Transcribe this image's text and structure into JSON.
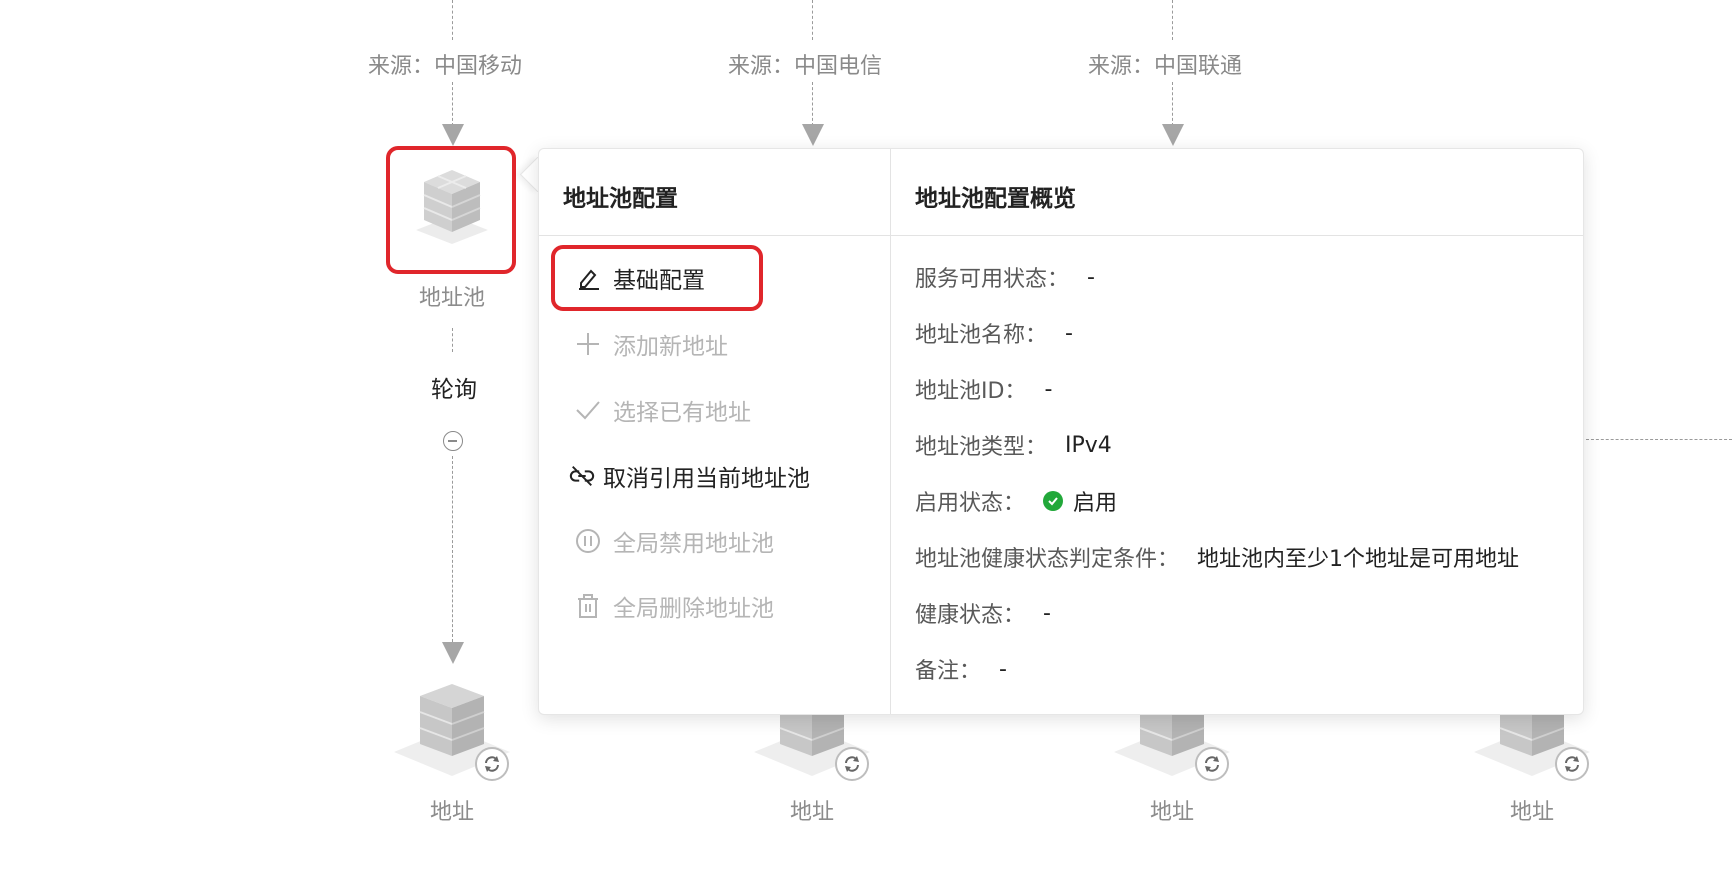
{
  "sources": [
    {
      "label": "来源：中国移动"
    },
    {
      "label": "来源：中国电信"
    },
    {
      "label": "来源：中国联通"
    }
  ],
  "pool_node": {
    "label": "地址池"
  },
  "poll": {
    "label": "轮询"
  },
  "address_nodes": [
    {
      "label": "地址"
    },
    {
      "label": "地址"
    },
    {
      "label": "地址"
    },
    {
      "label": "地址"
    }
  ],
  "popover": {
    "menu_title": "地址池配置",
    "overview_title": "地址池配置概览",
    "menu": [
      {
        "label": "基础配置",
        "icon": "edit-icon",
        "enabled": true
      },
      {
        "label": "添加新地址",
        "icon": "plus-icon",
        "enabled": false
      },
      {
        "label": "选择已有地址",
        "icon": "check-icon",
        "enabled": false
      },
      {
        "label": "取消引用当前地址池",
        "icon": "unlink-icon",
        "enabled": true
      },
      {
        "label": "全局禁用地址池",
        "icon": "pause-circle-icon",
        "enabled": false
      },
      {
        "label": "全局删除地址池",
        "icon": "trash-icon",
        "enabled": false
      }
    ],
    "overview": [
      {
        "key": "服务可用状态：",
        "value": "-"
      },
      {
        "key": "地址池名称：",
        "value": "-"
      },
      {
        "key": "地址池ID：",
        "value": "-"
      },
      {
        "key": "地址池类型：",
        "value": "IPv4"
      },
      {
        "key": "启用状态：",
        "value": "启用"
      },
      {
        "key": "地址池健康状态判定条件：",
        "value": "地址池内至少1个地址是可用地址"
      },
      {
        "key": "健康状态：",
        "value": "-"
      },
      {
        "key": "备注：",
        "value": "-"
      }
    ]
  },
  "colors": {
    "highlight": "#e0262b",
    "enabled_status": "#22a83a"
  }
}
